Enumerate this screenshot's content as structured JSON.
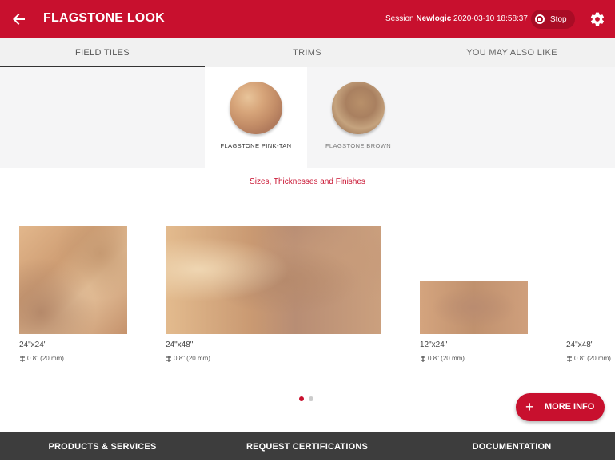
{
  "header": {
    "title": "FLAGSTONE LOOK",
    "session_prefix": "Session ",
    "session_user": "Newlogic",
    "session_time": " 2020-03-10 18:58:37",
    "stop_label": "Stop",
    "accent_color": "#c8102e"
  },
  "tabs": [
    {
      "label": "FIELD TILES",
      "active": true
    },
    {
      "label": "TRIMS",
      "active": false
    },
    {
      "label": "YOU MAY ALSO LIKE",
      "active": false
    }
  ],
  "colors": [
    {
      "label": "FLAGSTONE PINK-TAN",
      "selected": true
    },
    {
      "label": "FLAGSTONE BROWN",
      "selected": false
    }
  ],
  "sizes_link": "Sizes, Thicknesses and Finishes",
  "tiles": [
    {
      "size": "24\"x24\"",
      "thickness": "0.8\" (20 mm)"
    },
    {
      "size": "24\"x48\"",
      "thickness": "0.8\" (20 mm)"
    },
    {
      "size": "12\"x24\"",
      "thickness": "0.8\" (20 mm)"
    },
    {
      "size": "24\"x48\"",
      "thickness": "0.8\" (20 mm)"
    }
  ],
  "pager": {
    "pages": 2,
    "current": 1
  },
  "more_info_label": "MORE INFO",
  "bottom_nav": [
    {
      "label": "PRODUCTS & SERVICES"
    },
    {
      "label": "REQUEST CERTIFICATIONS"
    },
    {
      "label": "DOCUMENTATION"
    }
  ]
}
